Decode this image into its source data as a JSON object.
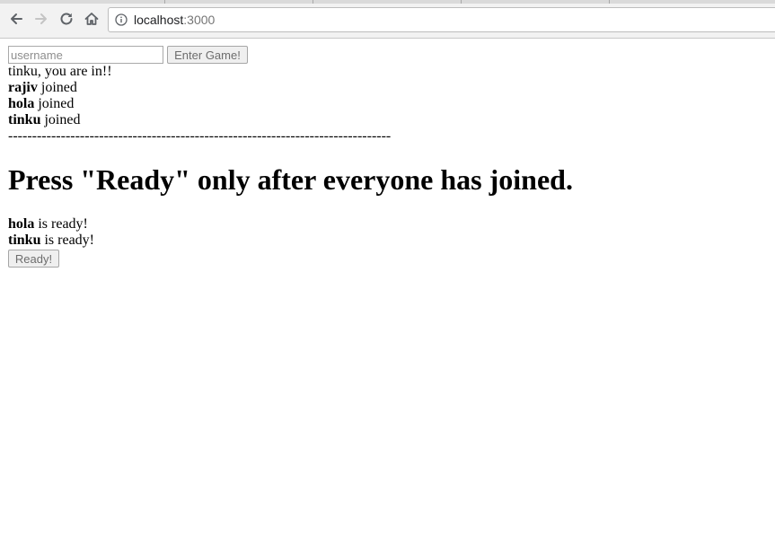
{
  "browser": {
    "url_host": "localhost",
    "url_port": ":3000"
  },
  "join": {
    "username_placeholder": "username",
    "username_value": "",
    "enter_label": "Enter Game!"
  },
  "welcome_message": "tinku, you are in!!",
  "joined_players": [
    {
      "name": "rajiv",
      "text": " joined"
    },
    {
      "name": "hola",
      "text": " joined"
    },
    {
      "name": "tinku",
      "text": " joined"
    }
  ],
  "divider": "--------------------------------------------------------------------------------",
  "instruction": "Press \"Ready\" only after everyone has joined.",
  "ready_players": [
    {
      "name": "hola",
      "text": " is ready!"
    },
    {
      "name": "tinku",
      "text": " is ready!"
    }
  ],
  "ready_label": "Ready!"
}
